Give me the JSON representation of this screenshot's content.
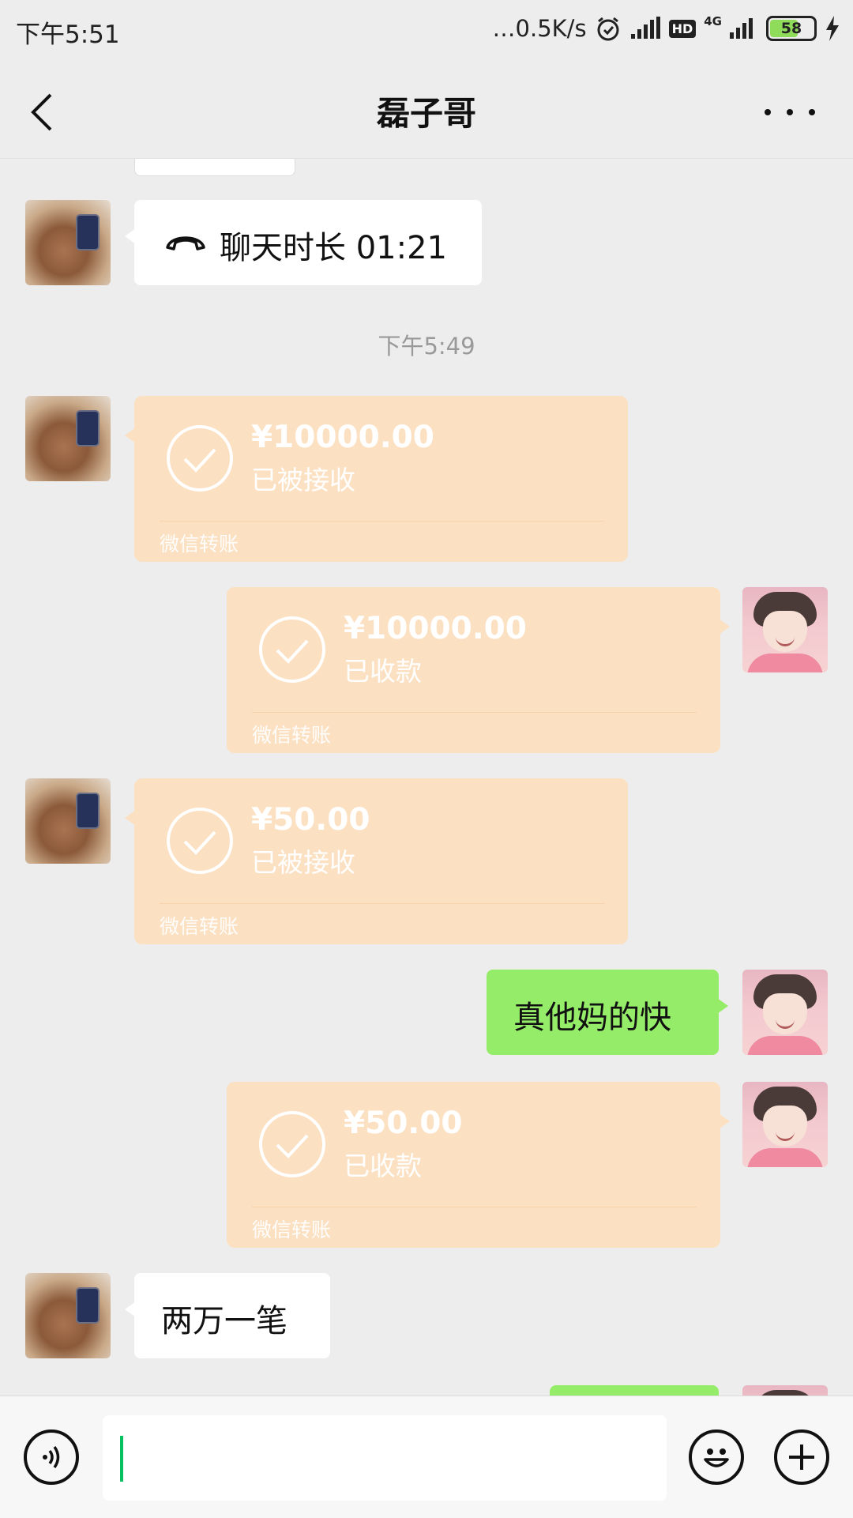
{
  "status_bar": {
    "time": "下午5:51",
    "network_speed": "…0.5K/s",
    "hd": "HD",
    "network_type": "4G",
    "battery": "58",
    "icons": [
      "alarm-icon",
      "signal-icon",
      "hd-icon",
      "signal-4g-icon",
      "battery-icon",
      "charging-icon"
    ]
  },
  "nav": {
    "title": "磊子哥",
    "back_icon": "chevron-left-icon",
    "more_icon": "more-dots-icon"
  },
  "messages": {
    "call": {
      "label": "聊天时长 01:21",
      "icon": "phone-hangup-icon"
    },
    "time_separator": "下午5:49",
    "transfer1": {
      "amount": "¥10000.00",
      "status": "已被接收",
      "footer": "微信转账"
    },
    "transfer2": {
      "amount": "¥10000.00",
      "status": "已收款",
      "footer": "微信转账"
    },
    "transfer3": {
      "amount": "¥50.00",
      "status": "已被接收",
      "footer": "微信转账"
    },
    "text1": "真他妈的快",
    "transfer4": {
      "amount": "¥50.00",
      "status": "已收款",
      "footer": "微信转账"
    },
    "text2": "两万一笔"
  },
  "input_bar": {
    "voice_icon": "voice-icon",
    "emoji_icon": "emoji-icon",
    "plus_icon": "plus-icon",
    "input_value": ""
  },
  "colors": {
    "background": "#ededed",
    "green_bubble": "#95ec69",
    "transfer_bubble": "#fce0c2",
    "caret": "#07c160"
  }
}
